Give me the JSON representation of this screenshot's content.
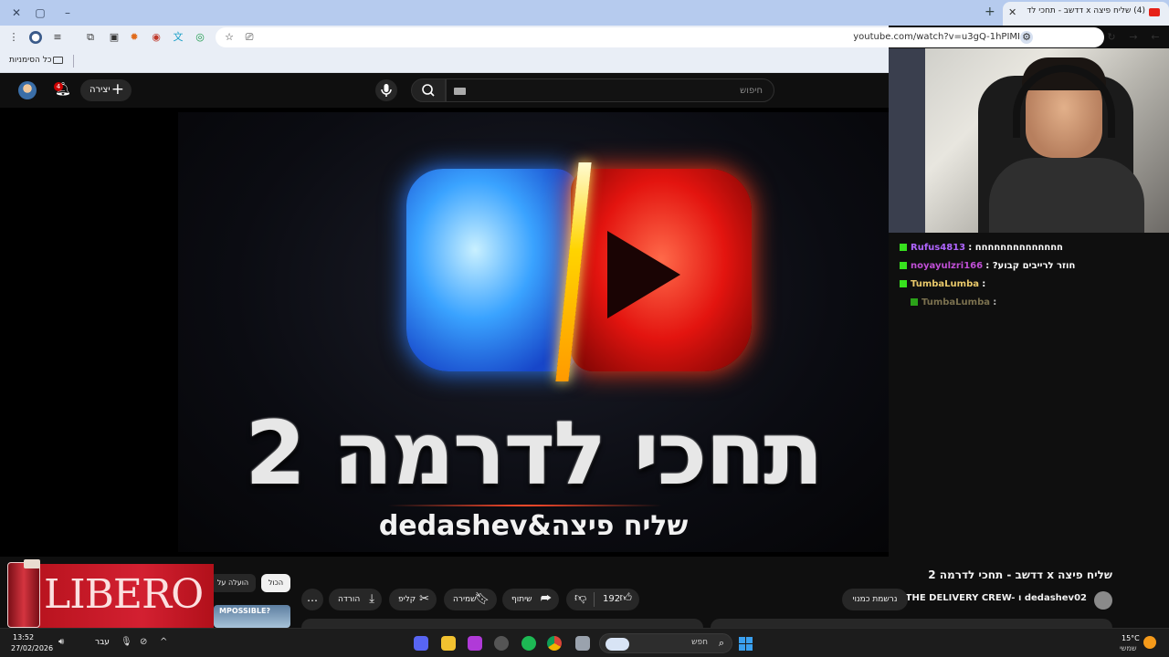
{
  "browser": {
    "tab_title": "(4) שליח פיצה x דדשב - תחכי לדרמה 2",
    "url": "youtube.com/watch?v=u3gQ-1hPIMI",
    "bookmarks_label": "כל הסימניות"
  },
  "youtube": {
    "create_label": "יצירה",
    "notification_count": "4",
    "search_placeholder": "חיפוש",
    "thumbnail_title": "תחכי לדרמה 2",
    "thumbnail_subtitle": "dedashev&שליח פיצה",
    "video_title": "שליח פיצה x דדשב - תחכי לדרמה 2",
    "channel_name": "THE DELIVERY CREW- ו dedashev02",
    "subscribed_label": "נרשמת כמנוי",
    "like_count": "192",
    "share_label": "שיתוף",
    "save_label": "שמירה",
    "clip_label": "קליפ",
    "download_label": "הורדה",
    "chip_all": "הכול",
    "chip_uploaded": "הועלה על",
    "related_thumb_text": "MPOSSIBLE?"
  },
  "ad": {
    "brand": "LIBERO"
  },
  "chat": {
    "messages": [
      {
        "user": "Rufus4813",
        "text": ": חחחחחחחחחחחחחח",
        "color": "#b065ff"
      },
      {
        "user": "noyayulzri166",
        "text": ": ?חוזר לרייבים קבוע",
        "color": "#c04fd6"
      },
      {
        "user": "TumbaLumba",
        "text": ":",
        "color": "#e8c86a"
      },
      {
        "user": "TumbaLumba",
        "text": ":",
        "color": "#a89a6a"
      }
    ]
  },
  "taskbar": {
    "time": "13:52",
    "date": "27/02/2026",
    "language": "עבר",
    "search_label": "חפש",
    "temperature": "15°C",
    "weather_desc": "שמשי"
  },
  "colors": {
    "yt_bg": "#0f0f0f",
    "accent_red": "#e62117",
    "chat_badge": "#37e11e"
  }
}
